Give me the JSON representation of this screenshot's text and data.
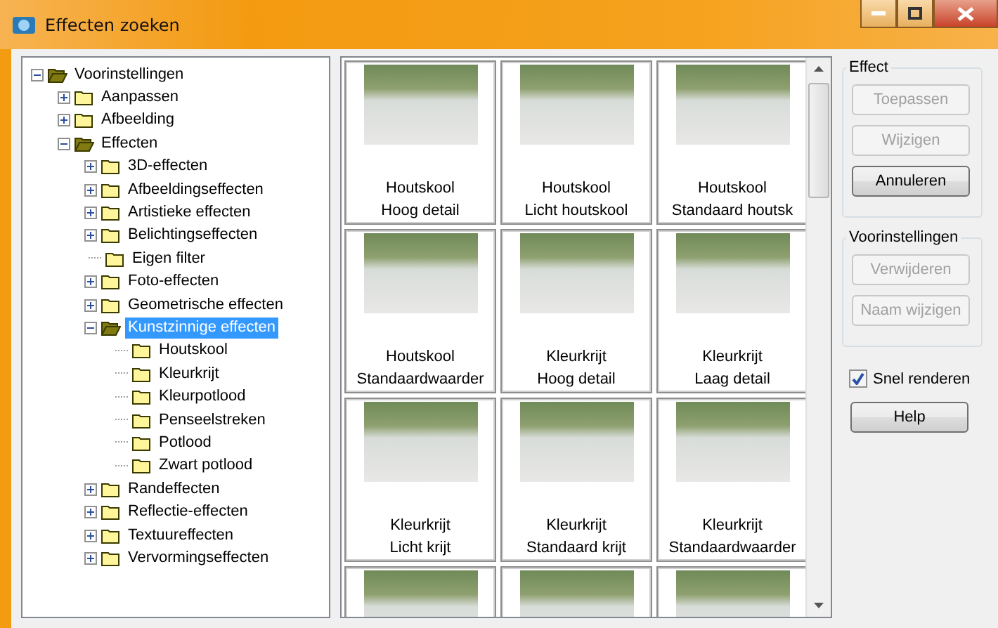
{
  "window": {
    "title": "Effecten zoeken"
  },
  "tree": [
    {
      "label": "Voorinstellingen",
      "kind": "folder",
      "expanded": true,
      "selected": false,
      "children": [
        {
          "label": "Aanpassen",
          "kind": "folder",
          "expanded": false,
          "selected": false
        },
        {
          "label": "Afbeelding",
          "kind": "folder",
          "expanded": false,
          "selected": false
        },
        {
          "label": "Effecten",
          "kind": "folder",
          "expanded": true,
          "selected": false,
          "children": [
            {
              "label": "3D-effecten",
              "kind": "folder",
              "expanded": false,
              "selected": false
            },
            {
              "label": "Afbeeldingseffecten",
              "kind": "folder",
              "expanded": false,
              "selected": false
            },
            {
              "label": "Artistieke effecten",
              "kind": "folder",
              "expanded": false,
              "selected": false
            },
            {
              "label": "Belichtingseffecten",
              "kind": "folder",
              "expanded": false,
              "selected": false
            },
            {
              "label": "Eigen filter",
              "kind": "leaf",
              "selected": false
            },
            {
              "label": "Foto-effecten",
              "kind": "folder",
              "expanded": false,
              "selected": false
            },
            {
              "label": "Geometrische effecten",
              "kind": "folder",
              "expanded": false,
              "selected": false
            },
            {
              "label": "Kunstzinnige effecten",
              "kind": "folder",
              "expanded": true,
              "selected": true,
              "children": [
                {
                  "label": "Houtskool",
                  "kind": "leaf",
                  "selected": false
                },
                {
                  "label": "Kleurkrijt",
                  "kind": "leaf",
                  "selected": false
                },
                {
                  "label": "Kleurpotlood",
                  "kind": "leaf",
                  "selected": false
                },
                {
                  "label": "Penseelstreken",
                  "kind": "leaf",
                  "selected": false
                },
                {
                  "label": "Potlood",
                  "kind": "leaf",
                  "selected": false
                },
                {
                  "label": "Zwart potlood",
                  "kind": "leaf",
                  "selected": false
                }
              ]
            },
            {
              "label": "Randeffecten",
              "kind": "folder",
              "expanded": false,
              "selected": false
            },
            {
              "label": "Reflectie-effecten",
              "kind": "folder",
              "expanded": false,
              "selected": false
            },
            {
              "label": "Textuureffecten",
              "kind": "folder",
              "expanded": false,
              "selected": false
            },
            {
              "label": "Vervormingseffecten",
              "kind": "folder",
              "expanded": false,
              "selected": false
            }
          ]
        }
      ]
    }
  ],
  "tiles": [
    {
      "kind": "full",
      "lines": [
        "Houtskool",
        "Hoog detail"
      ]
    },
    {
      "kind": "full",
      "lines": [
        "Houtskool",
        "Licht houtskool"
      ]
    },
    {
      "kind": "full",
      "lines": [
        "Houtskool",
        "Standaard houtsk"
      ]
    },
    {
      "kind": "full",
      "lines": [
        "Houtskool",
        "Standaardwaarder"
      ]
    },
    {
      "kind": "full",
      "lines": [
        "Kleurkrijt",
        "Hoog detail"
      ]
    },
    {
      "kind": "full",
      "lines": [
        "Kleurkrijt",
        "Laag detail"
      ]
    },
    {
      "kind": "full",
      "lines": [
        "Kleurkrijt",
        "Licht krijt"
      ]
    },
    {
      "kind": "full",
      "lines": [
        "Kleurkrijt",
        "Standaard krijt"
      ]
    },
    {
      "kind": "full",
      "lines": [
        "Kleurkrijt",
        "Standaardwaarder"
      ]
    },
    {
      "kind": "partial"
    },
    {
      "kind": "partial"
    },
    {
      "kind": "partial"
    }
  ],
  "groups": [
    {
      "title": "Effect",
      "buttons": [
        {
          "label": "Toepassen",
          "disabled": true
        },
        {
          "label": "Wijzigen",
          "disabled": true
        },
        {
          "label": "Annuleren",
          "disabled": false
        }
      ]
    },
    {
      "title": "Voorinstellingen",
      "buttons": [
        {
          "label": "Verwijderen",
          "disabled": true
        },
        {
          "label": "Naam wijzigen",
          "disabled": true
        }
      ]
    }
  ],
  "fast_render": {
    "label": "Snel renderen",
    "checked": true
  },
  "help_button": {
    "label": "Help",
    "disabled": false
  }
}
